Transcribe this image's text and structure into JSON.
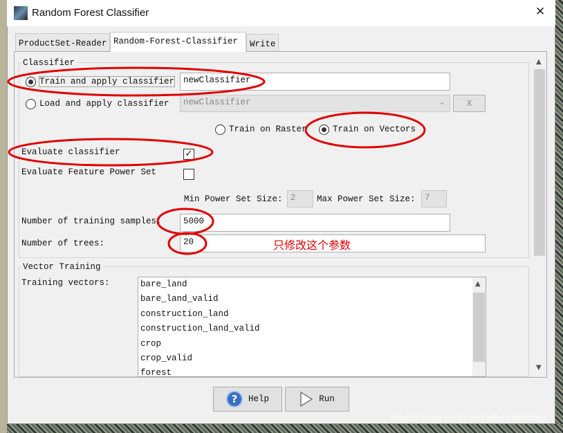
{
  "window": {
    "title": "Random Forest Classifier",
    "close_icon": "close-icon",
    "app_icon": "snap-icon"
  },
  "tabs": [
    {
      "label": "ProductSet-Reader"
    },
    {
      "label": "Random-Forest-Classifier",
      "selected": true
    },
    {
      "label": "Write"
    }
  ],
  "classifier": {
    "group_label": "Classifier",
    "train_apply_label": "Train and apply classifier",
    "train_apply_selected": true,
    "train_name_value": "newClassifier",
    "load_apply_label": "Load and apply classifier",
    "load_name_value": "newClassifier",
    "clear_button": "X",
    "train_on_raster_label": "Train on Raster",
    "train_on_vectors_label": "Train on Vectors",
    "train_on": "vectors",
    "evaluate_label": "Evaluate classifier",
    "evaluate_checked": true,
    "feature_power_label": "Evaluate Feature Power Set",
    "feature_power_checked": false,
    "min_power_label": "Min Power Set Size:",
    "min_power_value": "2",
    "max_power_label": "Max Power Set Size:",
    "max_power_value": "7",
    "samples_label": "Number of training samples:",
    "samples_value": "5000",
    "trees_label": "Number of trees:",
    "trees_value": "20",
    "annotation_text": "只修改这个参数"
  },
  "vector_training": {
    "group_label": "Vector Training",
    "vectors_label": "Training vectors:",
    "items": [
      "bare_land",
      "bare_land_valid",
      "construction_land",
      "construction_land_valid",
      "crop",
      "crop_valid",
      "forest"
    ]
  },
  "buttons": {
    "help": "Help",
    "run": "Run"
  },
  "watermark": "https://blog.csdn.net/lidahuilidahui",
  "colors": {
    "annotation": "#e00000"
  }
}
